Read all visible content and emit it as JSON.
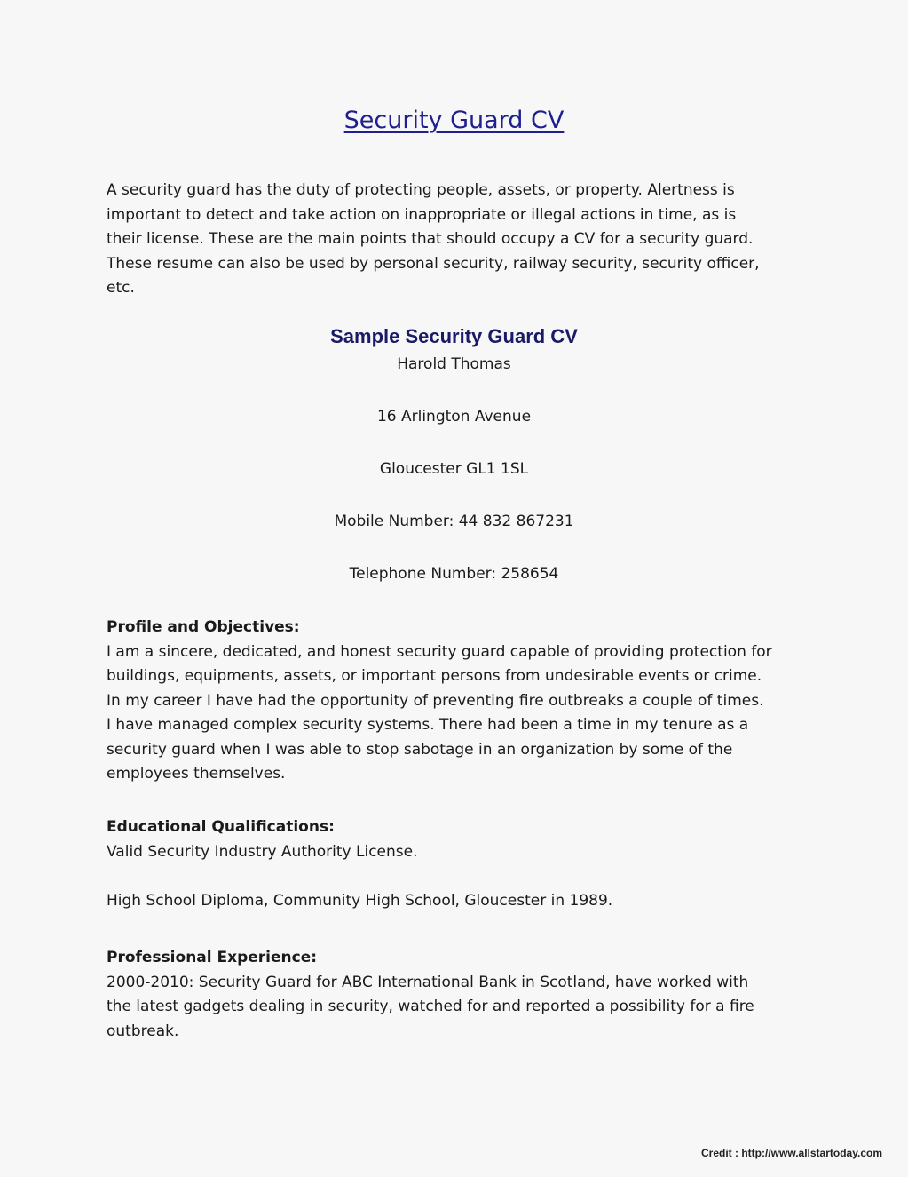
{
  "document": {
    "title": "Security Guard CV",
    "intro_lines": [
      "A security guard has the duty of protecting people, assets, or property.  Alertness is",
      "important to detect and take action on inappropriate or illegal actions in time, as is",
      "their license.  These are the main points that should occupy a CV for a security guard.",
      "These resume can also be used by personal security, railway security, security officer,",
      "etc."
    ],
    "sample_title": "Sample Security Guard CV",
    "contact": {
      "name": "Harold Thomas",
      "address_line1": "16 Arlington Avenue",
      "address_line2": "Gloucester GL1 1SL",
      "mobile": "Mobile Number: 44 832 867231",
      "telephone": "Telephone Number:  258654"
    },
    "profile": {
      "heading": "Profile and Objectives:",
      "lines": [
        "I am a sincere, dedicated, and honest security guard capable of providing protection for",
        "buildings, equipments, assets, or important persons from undesirable events or crime.",
        "In my career I have had the opportunity of preventing fire outbreaks a couple of times.",
        "I have managed complex security systems.  There had been a time in my tenure as a",
        "security guard when I was able to stop sabotage in an organization by some of the",
        "employees themselves."
      ]
    },
    "education": {
      "heading": "Educational Qualifications:",
      "items": [
        "Valid Security Industry Authority License.",
        "High School Diploma, Community High School, Gloucester in 1989."
      ]
    },
    "experience": {
      "heading": "Professional Experience:",
      "lines": [
        "2000-2010:  Security Guard for ABC International Bank in Scotland, have worked with",
        "the latest gadgets dealing in security, watched for and reported a possibility for a fire",
        "outbreak."
      ]
    }
  },
  "credit": "Credit : http://www.allstartoday.com"
}
